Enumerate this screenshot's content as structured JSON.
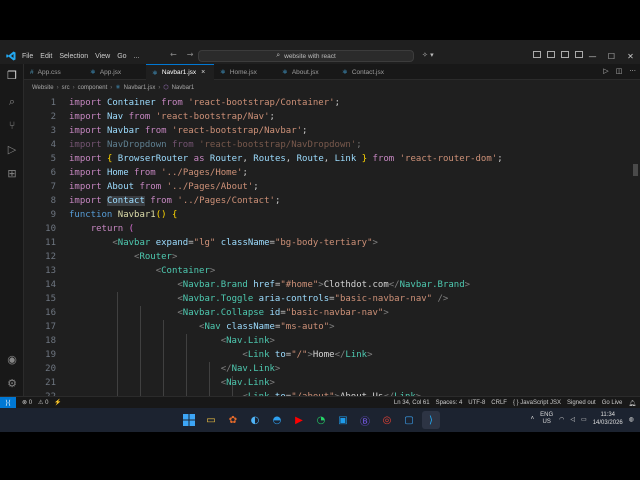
{
  "titlebar": {
    "menus": [
      "File",
      "Edit",
      "Selection",
      "View",
      "Go",
      "..."
    ],
    "search_text": "website with react",
    "nav_back": "←",
    "nav_forward": "→"
  },
  "tabs": [
    {
      "label": "App.css",
      "icon": "#",
      "icon_color": "#519aba",
      "active": false
    },
    {
      "label": "App.jsx",
      "icon": "⚛",
      "icon_color": "#4fc1ff",
      "active": false
    },
    {
      "label": "Navbar1.jsx",
      "icon": "⚛",
      "icon_color": "#4fc1ff",
      "active": true,
      "close": "×"
    },
    {
      "label": "Home.jsx",
      "icon": "⚛",
      "icon_color": "#4fc1ff",
      "active": false
    },
    {
      "label": "About.jsx",
      "icon": "⚛",
      "icon_color": "#4fc1ff",
      "active": false
    },
    {
      "label": "Contact.jsx",
      "icon": "⚛",
      "icon_color": "#4fc1ff",
      "active": false
    }
  ],
  "breadcrumb": [
    "Website",
    "src",
    "component",
    "Navbar1.jsx",
    "Navbar1"
  ],
  "editor": {
    "line_numbers": [
      "1",
      "2",
      "3",
      "4",
      "5",
      "6",
      "7",
      "8",
      "9",
      "10",
      "11",
      "12",
      "13",
      "14",
      "15",
      "16",
      "17",
      "18",
      "19",
      "20",
      "21",
      "22"
    ]
  },
  "statusbar": {
    "remote": "⟩⟨",
    "errors": "⊗ 0",
    "warnings": "⚠ 0",
    "ports": "⚡",
    "position": "Ln 34, Col 61",
    "spaces": "Spaces: 4",
    "encoding": "UTF-8",
    "eol": "CRLF",
    "language": "{ } JavaScript JSX",
    "signed_out": "Signed out",
    "go_live": "Go Live"
  },
  "tray": {
    "lang_top": "ENG",
    "lang_bottom": "US",
    "time": "11:34",
    "date": "14/03/2026"
  },
  "colors": {
    "accent": "#0078d4",
    "editor_bg": "#1f1f1f",
    "keyword": "#c586c0",
    "string": "#ce9178",
    "tag": "#4ec9b0"
  }
}
